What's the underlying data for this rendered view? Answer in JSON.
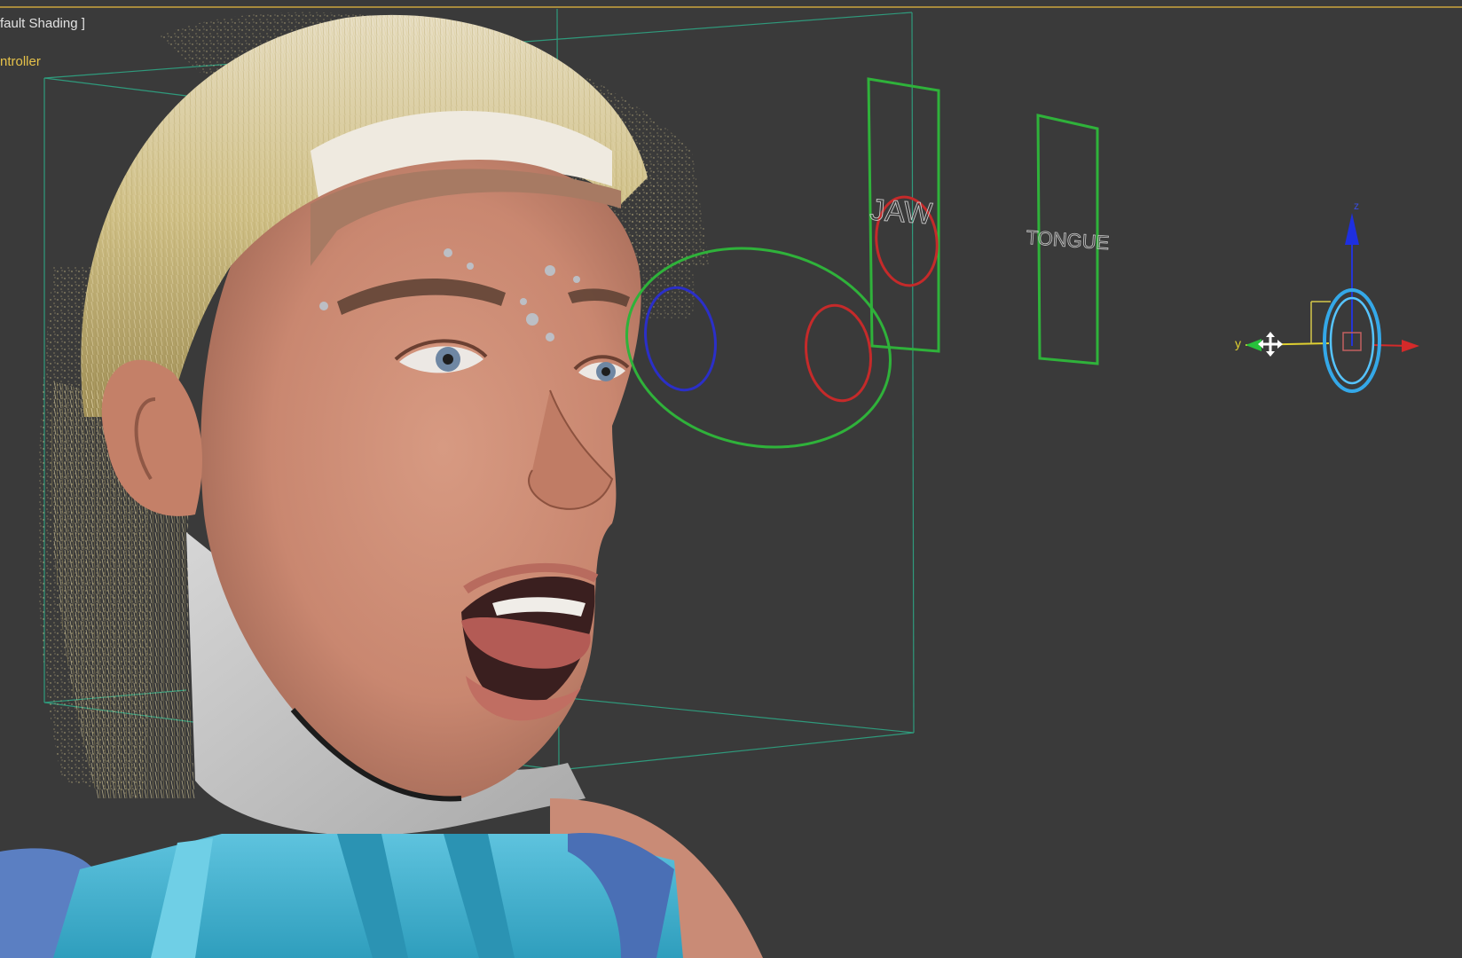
{
  "viewport": {
    "shading_label": "fault Shading ]",
    "object_label": "ntroller"
  },
  "controls": {
    "jaw_label": "JAW",
    "tongue_label": "TONGUE"
  },
  "gizmo": {
    "y_axis_label": "y",
    "z_axis_label": "z"
  },
  "colors": {
    "viewport_bg": "#3a3a3a",
    "active_border": "#a88a3c",
    "bounding_box": "#2f9a7c",
    "control_green": "#2fb23a",
    "control_red": "#c52a2a",
    "control_blue": "#2b2fc8",
    "gizmo_cyan": "#34a8e8"
  }
}
